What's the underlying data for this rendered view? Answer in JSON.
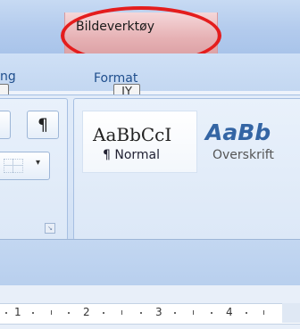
{
  "title_bar": {
    "contextual_tab_label": "Bildeverktøy",
    "highlight_color": "#e41d1d"
  },
  "tabs": {
    "left_tab_partial": "ng",
    "format_tab": "Format",
    "format_keytip": "JY"
  },
  "paragraph_group": {
    "show_marks_glyph": "¶",
    "dropdown_glyph": "▾",
    "launcher_glyph": "↘"
  },
  "styles_gallery": {
    "normal_preview": "AaBbCcI",
    "normal_label": "¶ Normal",
    "heading_preview": "AaBb",
    "heading_label": "Overskrift"
  },
  "ruler": {
    "numbers": [
      "1",
      "2",
      "3",
      "4"
    ]
  }
}
